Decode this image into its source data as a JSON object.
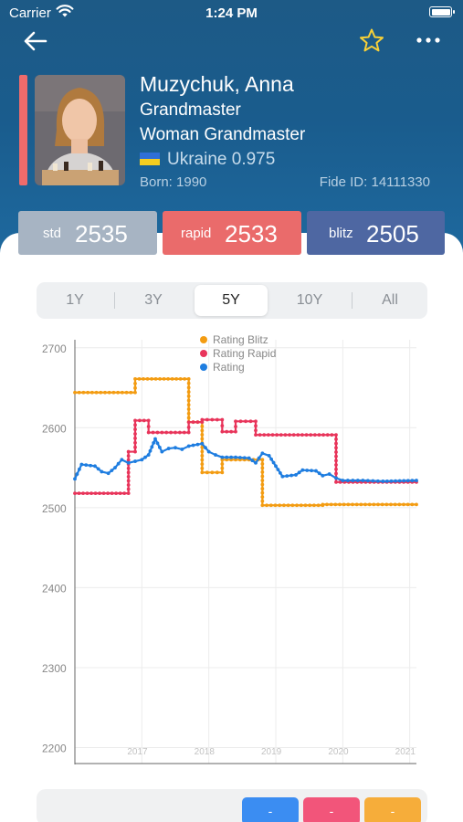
{
  "status_bar": {
    "carrier": "Carrier",
    "time": "1:24 PM"
  },
  "nav": {
    "back_icon": "back-arrow-icon",
    "favorite_icon": "star-outline-icon",
    "more_icon": "more-dots-icon"
  },
  "player": {
    "name": "Muzychuk, Anna",
    "titles": [
      "Grandmaster",
      "Woman Grandmaster"
    ],
    "country": "Ukraine 0.975",
    "born": "Born: 1990",
    "fide_id": "Fide ID: 14111330"
  },
  "ratings": [
    {
      "label": "std",
      "value": "2535",
      "color": "#a7b4c3"
    },
    {
      "label": "rapid",
      "value": "2533",
      "color": "#ea6b6b"
    },
    {
      "label": "blitz",
      "value": "2505",
      "color": "#4e67a2"
    }
  ],
  "periods": {
    "options": [
      "1Y",
      "3Y",
      "5Y",
      "10Y",
      "All"
    ],
    "selected": "5Y"
  },
  "chart_data": {
    "type": "line",
    "title": "",
    "xlabel": "",
    "ylabel": "",
    "x_ticks": [
      "2017",
      "2018",
      "2019",
      "2020",
      "2021"
    ],
    "y_ticks": [
      2200,
      2300,
      2400,
      2500,
      2600,
      2700
    ],
    "xlim": [
      2016.0,
      2021.1
    ],
    "ylim": [
      2180,
      2710
    ],
    "grid": true,
    "legend_position": "top-center",
    "series": [
      {
        "name": "Rating Blitz",
        "color": "#f39c12",
        "points": [
          [
            2016.0,
            2644
          ],
          [
            2016.9,
            2644
          ],
          [
            2016.9,
            2661
          ],
          [
            2017.7,
            2661
          ],
          [
            2017.7,
            2607
          ],
          [
            2017.9,
            2607
          ],
          [
            2017.9,
            2544
          ],
          [
            2018.2,
            2544
          ],
          [
            2018.2,
            2560
          ],
          [
            2018.8,
            2560
          ],
          [
            2018.8,
            2503
          ],
          [
            2019.7,
            2503
          ],
          [
            2019.7,
            2504
          ],
          [
            2021.1,
            2504
          ]
        ]
      },
      {
        "name": "Rating Rapid",
        "color": "#e8345a",
        "points": [
          [
            2016.0,
            2518
          ],
          [
            2016.8,
            2518
          ],
          [
            2016.8,
            2570
          ],
          [
            2016.9,
            2570
          ],
          [
            2016.9,
            2609
          ],
          [
            2017.1,
            2609
          ],
          [
            2017.1,
            2594
          ],
          [
            2017.7,
            2594
          ],
          [
            2017.7,
            2607
          ],
          [
            2017.9,
            2607
          ],
          [
            2017.9,
            2610
          ],
          [
            2018.2,
            2610
          ],
          [
            2018.2,
            2595
          ],
          [
            2018.4,
            2595
          ],
          [
            2018.4,
            2608
          ],
          [
            2018.7,
            2608
          ],
          [
            2018.7,
            2591
          ],
          [
            2019.9,
            2591
          ],
          [
            2019.9,
            2532
          ],
          [
            2021.1,
            2532
          ]
        ]
      },
      {
        "name": "Rating",
        "color": "#1e7de0",
        "points": [
          [
            2016.0,
            2536
          ],
          [
            2016.1,
            2554
          ],
          [
            2016.3,
            2552
          ],
          [
            2016.4,
            2545
          ],
          [
            2016.5,
            2543
          ],
          [
            2016.6,
            2550
          ],
          [
            2016.7,
            2560
          ],
          [
            2016.8,
            2556
          ],
          [
            2016.9,
            2558
          ],
          [
            2017.0,
            2560
          ],
          [
            2017.1,
            2566
          ],
          [
            2017.2,
            2586
          ],
          [
            2017.3,
            2570
          ],
          [
            2017.4,
            2574
          ],
          [
            2017.5,
            2575
          ],
          [
            2017.6,
            2573
          ],
          [
            2017.7,
            2577
          ],
          [
            2017.9,
            2580
          ],
          [
            2018.0,
            2570
          ],
          [
            2018.1,
            2566
          ],
          [
            2018.2,
            2563
          ],
          [
            2018.4,
            2563
          ],
          [
            2018.6,
            2562
          ],
          [
            2018.7,
            2556
          ],
          [
            2018.8,
            2568
          ],
          [
            2018.9,
            2565
          ],
          [
            2019.0,
            2552
          ],
          [
            2019.1,
            2539
          ],
          [
            2019.3,
            2541
          ],
          [
            2019.4,
            2547
          ],
          [
            2019.6,
            2546
          ],
          [
            2019.7,
            2540
          ],
          [
            2019.8,
            2542
          ],
          [
            2019.9,
            2537
          ],
          [
            2020.0,
            2534
          ],
          [
            2020.3,
            2534
          ],
          [
            2020.6,
            2533
          ],
          [
            2021.1,
            2534
          ]
        ]
      }
    ]
  },
  "bottom_bar": {
    "buttons": [
      {
        "label": "-",
        "color": "#3b8df2"
      },
      {
        "label": "-",
        "color": "#f2557a"
      },
      {
        "label": "-",
        "color": "#f6ad3a"
      }
    ]
  }
}
